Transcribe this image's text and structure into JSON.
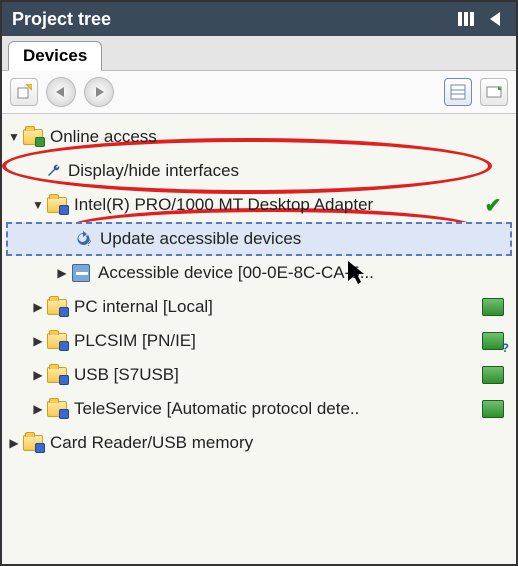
{
  "window": {
    "title": "Project tree"
  },
  "tabs": {
    "devices": "Devices"
  },
  "tree": {
    "online_access": "Online access",
    "display_hide": "Display/hide interfaces",
    "intel_adapter": "Intel(R) PRO/1000 MT Desktop Adapter",
    "update_accessible": "Update accessible devices",
    "accessible_device": "Accessible device [00-0E-8C-CA-5...",
    "pc_internal": "PC internal [Local]",
    "plcsim": "PLCSIM [PN/IE]",
    "usb": "USB [S7USB]",
    "teleservice": "TeleService [Automatic protocol dete..",
    "card_reader": "Card Reader/USB memory"
  }
}
